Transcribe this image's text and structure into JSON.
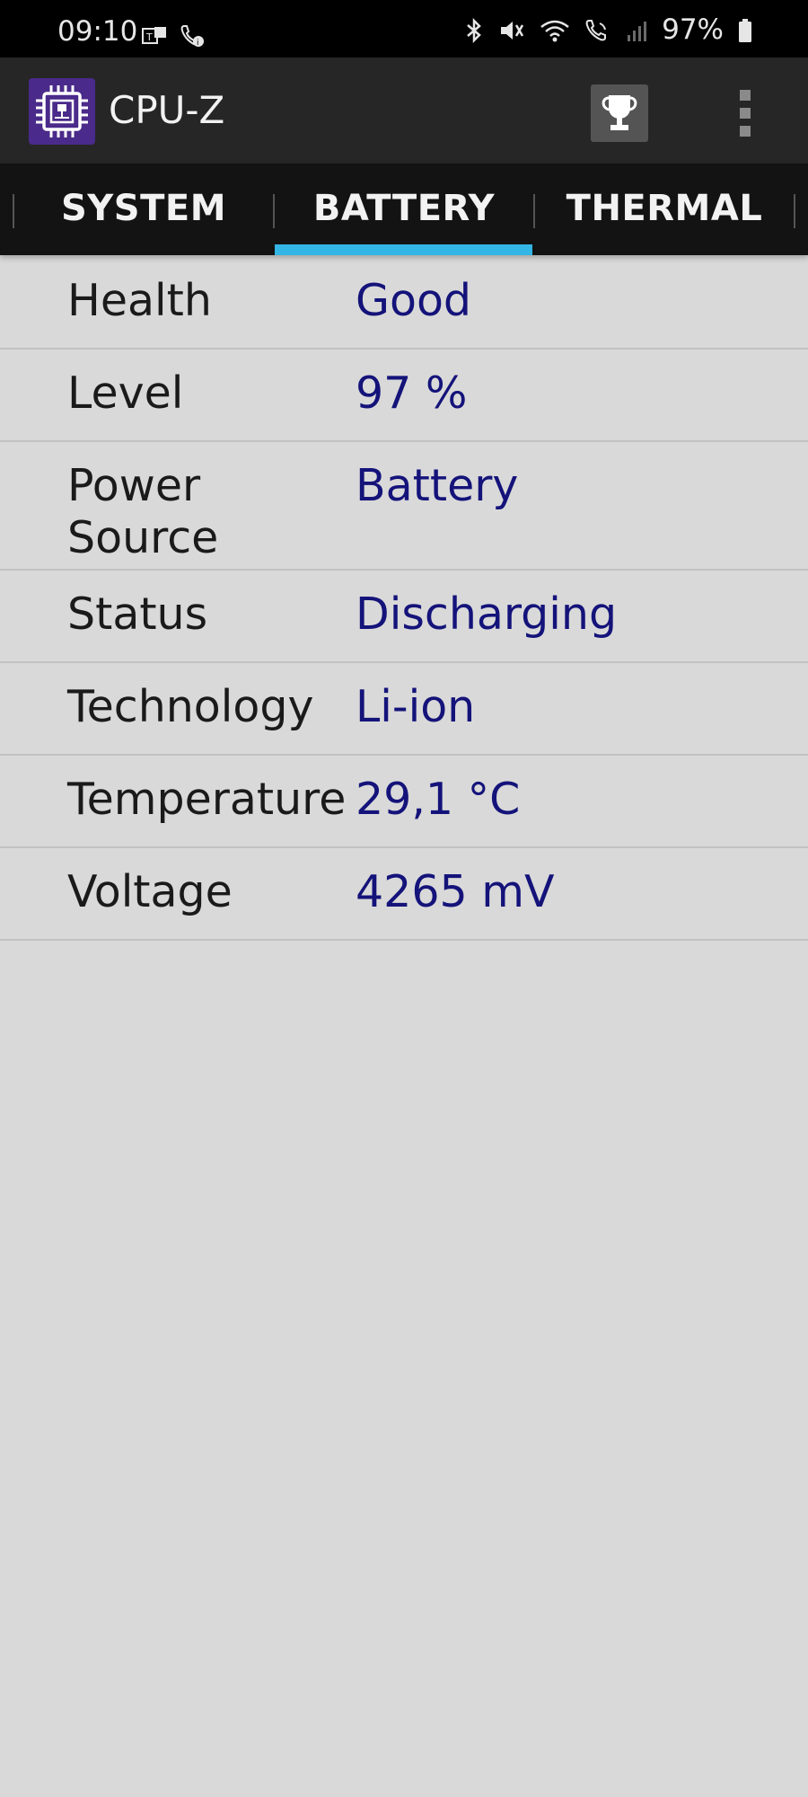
{
  "status_bar": {
    "time": "09:10",
    "battery_percent": "97%",
    "left_icons": [
      "teams-notification-icon",
      "wifi-call-icon"
    ],
    "right_icons": [
      "bluetooth-icon",
      "mute-icon",
      "wifi-icon",
      "volte-call-icon",
      "signal-icon",
      "battery-icon"
    ]
  },
  "app_bar": {
    "title": "CPU-Z",
    "logo_icon": "cpu-chip-icon",
    "trophy_icon": "trophy-icon",
    "menu_icon": "overflow-menu-icon"
  },
  "tabs": [
    {
      "label": "SYSTEM",
      "selected": false
    },
    {
      "label": "BATTERY",
      "selected": true
    },
    {
      "label": "THERMAL",
      "selected": false
    }
  ],
  "battery_info": [
    {
      "label": "Health",
      "value": "Good"
    },
    {
      "label": "Level",
      "value": "97 %"
    },
    {
      "label": "Power Source",
      "value": "Battery"
    },
    {
      "label": "Status",
      "value": "Discharging"
    },
    {
      "label": "Technology",
      "value": "Li-ion"
    },
    {
      "label": "Temperature",
      "value": "29,1 °C"
    },
    {
      "label": "Voltage",
      "value": "4265 mV"
    }
  ],
  "colors": {
    "accent": "#33b5e5",
    "value_text": "#14137a",
    "background": "#d9d9d9",
    "app_bar": "#262626",
    "tab_bar": "#131313"
  }
}
